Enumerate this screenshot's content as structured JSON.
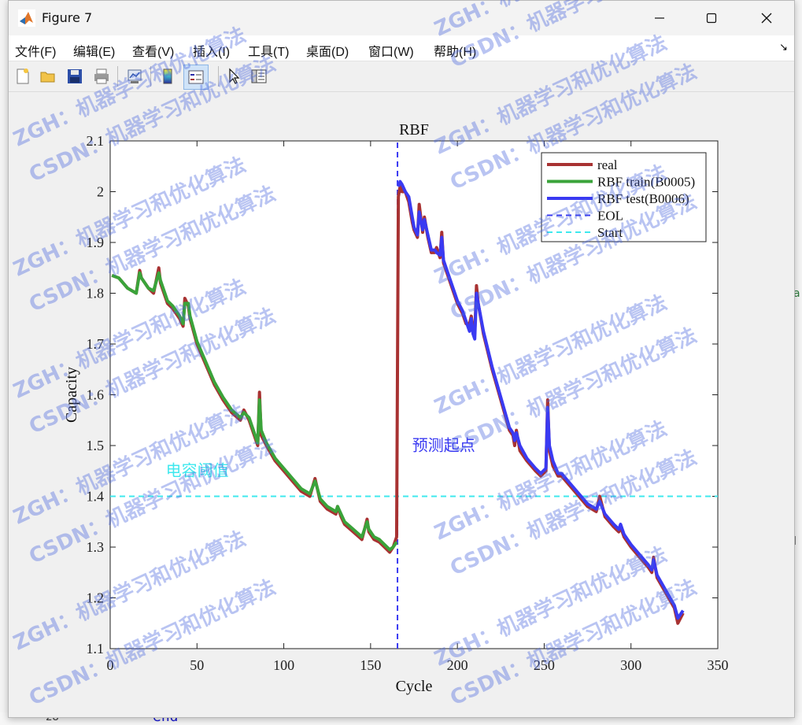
{
  "window": {
    "title": "Figure 7"
  },
  "background": {
    "line_number": "28",
    "code_text": "end",
    "side_text_1": "a",
    "side_text_2": "l"
  },
  "menu": [
    "文件(F)",
    "编辑(E)",
    "查看(V)",
    "插入(I)",
    "工具(T)",
    "桌面(D)",
    "窗口(W)",
    "帮助(H)"
  ],
  "toolbar_icons": [
    "new-figure-icon",
    "open-icon",
    "save-icon",
    "print-icon",
    "link-plot-icon",
    "insert-colorbar-icon",
    "insert-legend-icon",
    "pointer-icon",
    "property-inspector-icon"
  ],
  "watermarks": [
    "ZGH：机器学习和优化算法",
    "CSDN：机器学习和优化算法"
  ],
  "colors": {
    "real": "#a83232",
    "train": "#3aa33a",
    "test": "#3a3af2",
    "eol": "#3a3af2",
    "start": "#3fe8ee"
  },
  "chart_data": {
    "type": "line",
    "title": "RBF",
    "xlabel": "Cycle",
    "ylabel": "Capacity",
    "xlim": [
      0,
      350
    ],
    "ylim": [
      1.1,
      2.1
    ],
    "xticks": [
      "0",
      "50",
      "100",
      "150",
      "200",
      "250",
      "300",
      "350"
    ],
    "yticks": [
      "1.1",
      "1.2",
      "1.3",
      "1.4",
      "1.5",
      "1.6",
      "1.7",
      "1.8",
      "1.9",
      "2",
      "2.1"
    ],
    "legend_position": "top-right",
    "annotations": [
      {
        "text": "电容阈值",
        "x": 32,
        "y": 1.44,
        "color": "#3fe8ee"
      },
      {
        "text": "预测起点",
        "x": 174,
        "y": 1.49,
        "color": "#3a3af2"
      }
    ],
    "series": [
      {
        "name": "real",
        "style": "solid",
        "x": [
          1,
          5,
          10,
          15,
          17,
          18,
          22,
          25,
          28,
          29,
          33,
          36,
          40,
          42,
          43,
          45,
          46,
          50,
          55,
          60,
          65,
          70,
          75,
          77,
          80,
          85,
          86,
          87,
          90,
          95,
          100,
          105,
          110,
          115,
          118,
          119,
          121,
          125,
          130,
          131,
          133,
          135,
          140,
          145,
          148,
          149,
          152,
          155,
          158,
          161,
          163,
          165,
          166,
          167,
          168,
          170,
          172,
          174,
          175,
          177,
          178,
          180,
          181,
          183,
          185,
          187,
          188,
          190,
          191,
          192,
          193,
          195,
          197,
          200,
          203,
          205,
          207,
          208,
          209,
          210,
          211,
          212,
          215,
          220,
          225,
          230,
          232,
          233,
          234,
          236,
          240,
          245,
          248,
          251,
          252,
          253,
          255,
          258,
          260,
          265,
          270,
          275,
          280,
          282,
          285,
          290,
          293,
          294,
          296,
          300,
          305,
          310,
          312,
          313,
          315,
          320,
          325,
          327,
          330
        ],
        "y": [
          1.835,
          1.83,
          1.81,
          1.8,
          1.845,
          1.83,
          1.81,
          1.8,
          1.85,
          1.82,
          1.78,
          1.77,
          1.75,
          1.735,
          1.79,
          1.775,
          1.75,
          1.7,
          1.66,
          1.62,
          1.59,
          1.565,
          1.55,
          1.57,
          1.55,
          1.5,
          1.605,
          1.52,
          1.5,
          1.47,
          1.45,
          1.43,
          1.41,
          1.4,
          1.435,
          1.42,
          1.39,
          1.375,
          1.365,
          1.38,
          1.36,
          1.345,
          1.33,
          1.315,
          1.355,
          1.33,
          1.315,
          1.31,
          1.3,
          1.29,
          1.3,
          1.32,
          1.99,
          2.01,
          2.0,
          2.0,
          1.98,
          1.94,
          1.925,
          1.91,
          1.975,
          1.92,
          1.95,
          1.91,
          1.88,
          1.88,
          1.89,
          1.87,
          1.92,
          1.86,
          1.85,
          1.83,
          1.81,
          1.78,
          1.76,
          1.74,
          1.74,
          1.755,
          1.73,
          1.72,
          1.815,
          1.78,
          1.72,
          1.65,
          1.59,
          1.53,
          1.52,
          1.5,
          1.53,
          1.49,
          1.47,
          1.45,
          1.44,
          1.45,
          1.59,
          1.49,
          1.46,
          1.44,
          1.44,
          1.42,
          1.4,
          1.38,
          1.37,
          1.4,
          1.36,
          1.34,
          1.33,
          1.34,
          1.32,
          1.3,
          1.28,
          1.26,
          1.25,
          1.28,
          1.24,
          1.21,
          1.18,
          1.15,
          1.17
        ]
      },
      {
        "name": "RBF train(B0005)",
        "style": "solid",
        "x": [
          1,
          5,
          10,
          15,
          17,
          18,
          22,
          25,
          28,
          29,
          33,
          36,
          40,
          42,
          43,
          45,
          46,
          50,
          55,
          60,
          65,
          70,
          75,
          77,
          80,
          85,
          86,
          87,
          90,
          95,
          100,
          105,
          110,
          115,
          118,
          119,
          121,
          125,
          130,
          131,
          133,
          135,
          140,
          145,
          148,
          149,
          152,
          155,
          158,
          161,
          163,
          165
        ],
        "y": [
          1.835,
          1.83,
          1.81,
          1.8,
          1.84,
          1.83,
          1.81,
          1.805,
          1.84,
          1.825,
          1.785,
          1.775,
          1.755,
          1.74,
          1.78,
          1.78,
          1.755,
          1.705,
          1.665,
          1.625,
          1.595,
          1.57,
          1.555,
          1.565,
          1.555,
          1.505,
          1.59,
          1.53,
          1.505,
          1.475,
          1.455,
          1.435,
          1.415,
          1.405,
          1.43,
          1.42,
          1.395,
          1.38,
          1.37,
          1.38,
          1.365,
          1.35,
          1.335,
          1.32,
          1.35,
          1.335,
          1.32,
          1.315,
          1.305,
          1.295,
          1.3,
          1.31
        ]
      },
      {
        "name": "RBF test(B0006)",
        "style": "solid",
        "x": [
          166,
          167,
          168,
          170,
          172,
          174,
          175,
          177,
          178,
          180,
          181,
          183,
          185,
          187,
          188,
          190,
          191,
          192,
          193,
          195,
          197,
          200,
          203,
          205,
          207,
          208,
          209,
          210,
          211,
          212,
          215,
          220,
          225,
          230,
          232,
          233,
          234,
          236,
          240,
          245,
          248,
          251,
          252,
          253,
          255,
          258,
          260,
          265,
          270,
          275,
          280,
          282,
          285,
          290,
          293,
          294,
          296,
          300,
          305,
          310,
          312,
          313,
          315,
          320,
          325,
          327,
          330
        ],
        "y": [
          2.01,
          2.02,
          2.015,
          2.0,
          1.99,
          1.95,
          1.93,
          1.915,
          1.96,
          1.925,
          1.945,
          1.915,
          1.885,
          1.885,
          1.88,
          1.875,
          1.91,
          1.865,
          1.855,
          1.835,
          1.815,
          1.785,
          1.765,
          1.745,
          1.725,
          1.75,
          1.72,
          1.71,
          1.8,
          1.78,
          1.725,
          1.655,
          1.595,
          1.535,
          1.525,
          1.51,
          1.525,
          1.5,
          1.475,
          1.455,
          1.445,
          1.455,
          1.575,
          1.5,
          1.47,
          1.445,
          1.445,
          1.425,
          1.405,
          1.385,
          1.375,
          1.39,
          1.365,
          1.345,
          1.335,
          1.345,
          1.325,
          1.305,
          1.285,
          1.265,
          1.255,
          1.275,
          1.245,
          1.215,
          1.185,
          1.16,
          1.175
        ]
      },
      {
        "name": "EOL",
        "style": "dashed",
        "x": [
          165.5,
          165.5
        ],
        "y": [
          1.1,
          2.1
        ]
      },
      {
        "name": "Start",
        "style": "dashed",
        "x": [
          0,
          350
        ],
        "y": [
          1.4,
          1.4
        ]
      }
    ]
  }
}
